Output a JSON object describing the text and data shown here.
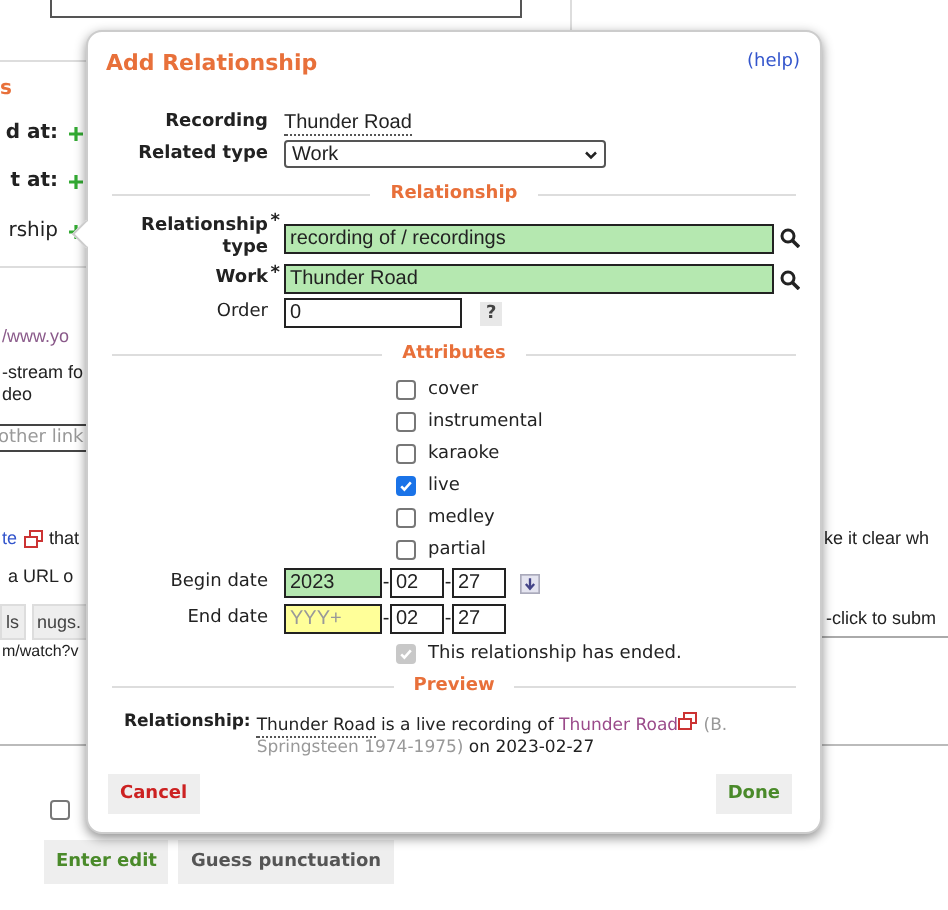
{
  "background": {
    "section_heading": "s",
    "rows": [
      {
        "label": "d at:"
      },
      {
        "label": "t at:"
      },
      {
        "label": "rship"
      }
    ],
    "url_link": "/www.yo",
    "desc_lines": [
      "-stream fo",
      "deo"
    ],
    "link_field": {
      "placeholder": "other link"
    },
    "note_link": "te",
    "note_text": "that",
    "note_line2": "a URL o",
    "note_right": "ke it clear wh",
    "hint_right": "-click to subm",
    "tag_buttons": [
      "ls",
      "nugs."
    ],
    "url_text": "m/watch?v",
    "minor_checkbox": {
      "checked": false
    },
    "buttons": [
      {
        "label": "Enter edit",
        "kind": "primary"
      },
      {
        "label": "Guess punctuation",
        "kind": "plain"
      }
    ]
  },
  "dialog": {
    "title": "Add Relationship",
    "help": "(help)",
    "recording": {
      "label": "Recording",
      "value": "Thunder Road"
    },
    "related_type": {
      "label": "Related type",
      "value": "Work"
    },
    "relationship_heading": "Relationship",
    "relationship_type": {
      "label": "Relationship type",
      "marker": "*",
      "value": "recording of / recordings"
    },
    "work": {
      "label": "Work",
      "marker": "*",
      "value": "Thunder Road"
    },
    "order": {
      "label": "Order",
      "value": "0",
      "help": "?"
    },
    "attributes_heading": "Attributes",
    "attributes": [
      {
        "label": "cover",
        "checked": false
      },
      {
        "label": "instrumental",
        "checked": false
      },
      {
        "label": "karaoke",
        "checked": false
      },
      {
        "label": "live",
        "checked": true
      },
      {
        "label": "medley",
        "checked": false
      },
      {
        "label": "partial",
        "checked": false
      }
    ],
    "dates": [
      {
        "label": "Begin date",
        "year": "2023",
        "year_valid": true,
        "separator": "-",
        "month": "02",
        "day": "27",
        "copy_button": true
      },
      {
        "label": "End date",
        "year": "YYY+",
        "year_valid": false,
        "separator": "-",
        "month": "02",
        "day": "27"
      }
    ],
    "ended": {
      "label": "This relationship has ended.",
      "checked": true,
      "disabled": true
    },
    "preview_heading": "Preview",
    "preview": {
      "label": "Relationship:",
      "parts": [
        {
          "kind": "entity",
          "text": "Thunder Road"
        },
        {
          "kind": "text",
          "text": " is a live recording of "
        },
        {
          "kind": "link",
          "text": "Thunder Road"
        },
        {
          "kind": "muted",
          "text": " (B. Springsteen 1974-1975)"
        },
        {
          "kind": "text",
          "text": " on 2023-02-27"
        }
      ]
    },
    "cancel": "Cancel",
    "done": "Done"
  }
}
